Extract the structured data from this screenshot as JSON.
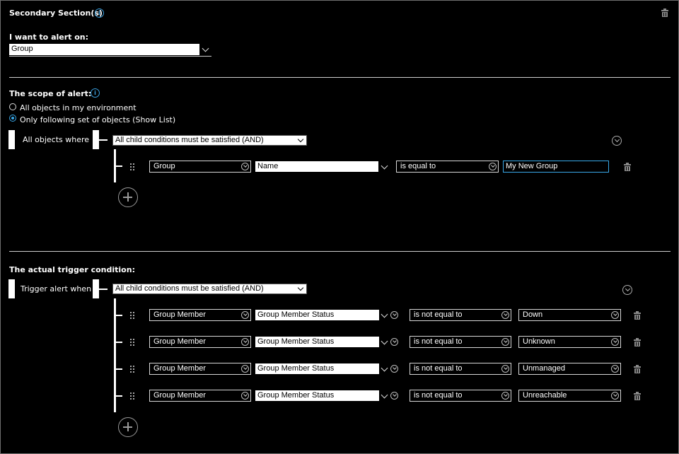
{
  "secondary": {
    "title": "Secondary Section(s)"
  },
  "alert_on": {
    "label": "I want to alert on:",
    "value": "Group"
  },
  "scope": {
    "label": "The scope of alert:",
    "radio_all": "All objects in my environment",
    "radio_only": "Only following set of objects (Show List)",
    "selected": "Only following set of objects (Show List)",
    "where_label": "All objects where",
    "and_condition": "All child conditions must be satisfied (AND)",
    "condition": {
      "object": "Group",
      "property": "Name",
      "operator": "is equal to",
      "value": "My New Group"
    }
  },
  "trigger": {
    "label": "The actual trigger condition:",
    "when_label": "Trigger alert when",
    "and_condition": "All child conditions must be satisfied (AND)",
    "rows": [
      {
        "object": "Group Member",
        "property": "Group Member Status",
        "operator": "is not equal to",
        "value": "Down"
      },
      {
        "object": "Group Member",
        "property": "Group Member Status",
        "operator": "is not equal to",
        "value": "Unknown"
      },
      {
        "object": "Group Member",
        "property": "Group Member Status",
        "operator": "is not equal to",
        "value": "Unmanaged"
      },
      {
        "object": "Group Member",
        "property": "Group Member Status",
        "operator": "is not equal to",
        "value": "Unreachable"
      }
    ]
  },
  "colors": {
    "accent": "#39a8e8",
    "background": "#000000",
    "border": "#d8d8d8"
  },
  "icons": {
    "info": "info-icon",
    "delete": "trash-icon",
    "add": "plus-circle-icon",
    "drag": "drag-handle-icon",
    "expand": "chevron-circle-icon"
  }
}
